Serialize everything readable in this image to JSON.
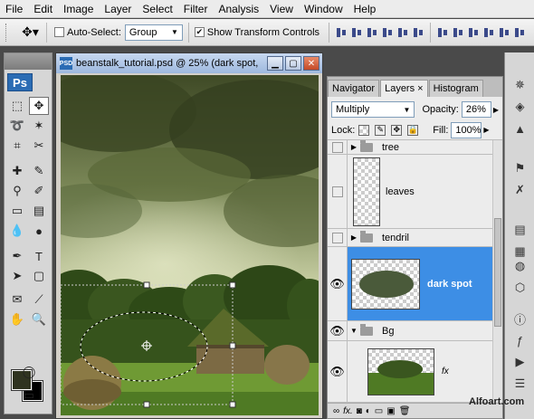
{
  "menu": [
    "File",
    "Edit",
    "Image",
    "Layer",
    "Select",
    "Filter",
    "Analysis",
    "View",
    "Window",
    "Help"
  ],
  "options": {
    "auto_select_label": "Auto-Select:",
    "auto_select_checked": false,
    "auto_select_value": "Group",
    "show_transform_label": "Show Transform Controls",
    "show_transform_checked": true
  },
  "tools": {
    "logo": "Ps",
    "foreground_color": "#2f3320",
    "background_color": "#000000"
  },
  "document": {
    "title": "beanstalk_tutorial.psd @ 25% (dark spot,"
  },
  "layers_panel": {
    "tabs": [
      "Navigator",
      "Layers",
      "Histogram"
    ],
    "active_tab": "Layers",
    "blend_mode": "Multiply",
    "opacity_label": "Opacity:",
    "opacity_value": "26%",
    "lock_label": "Lock:",
    "fill_label": "Fill:",
    "fill_value": "100%",
    "layers": [
      {
        "name": "tree",
        "type": "group",
        "visible": false
      },
      {
        "name": "leaves",
        "type": "layer",
        "visible": false
      },
      {
        "name": "tendril",
        "type": "group",
        "visible": false
      },
      {
        "name": "dark spot",
        "type": "layer",
        "visible": true,
        "selected": true
      },
      {
        "name": "Bg",
        "type": "group",
        "visible": true,
        "expanded": true
      },
      {
        "name": "",
        "type": "layer",
        "visible": true
      }
    ],
    "fx_label": "fx",
    "footer_fx": "fx."
  },
  "watermark": "Alfoart.com",
  "colors": {
    "selection_blue": "#3d8ee5",
    "ps_blue": "#2b6cb4"
  }
}
